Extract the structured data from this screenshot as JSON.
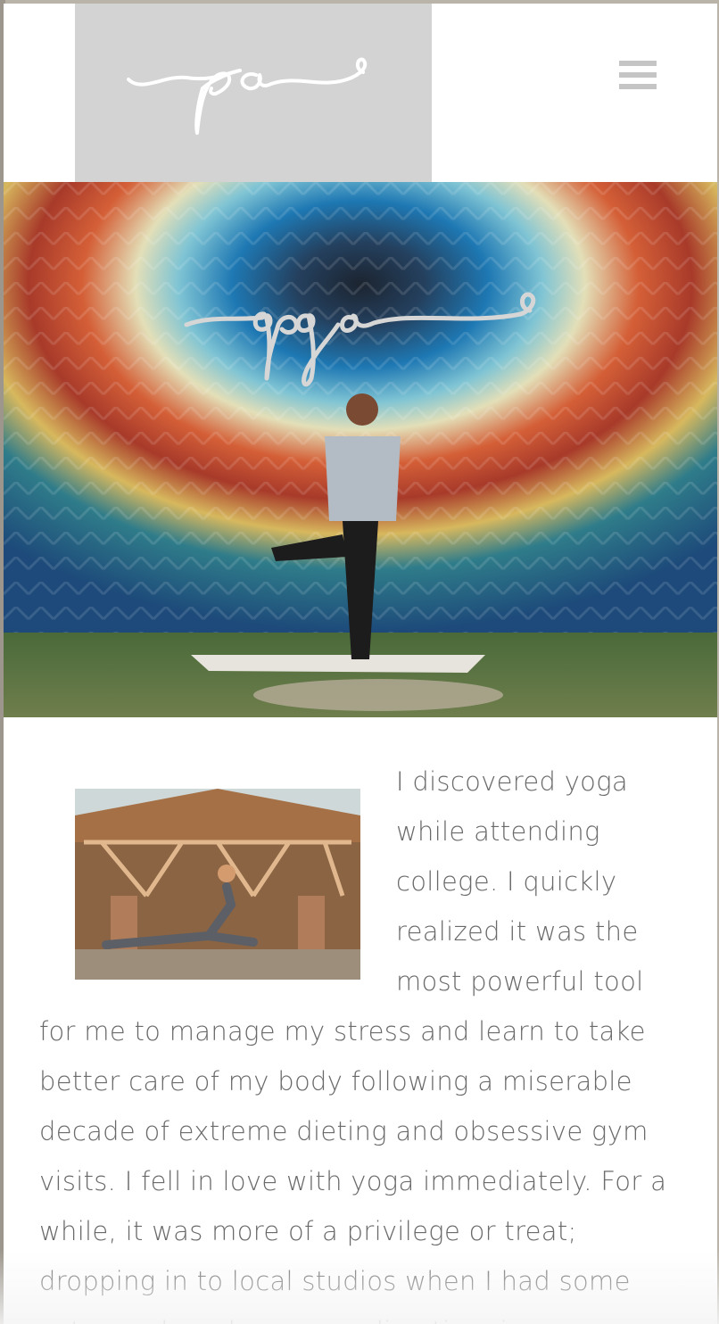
{
  "header": {
    "logo_text": "pa",
    "menu_icon": "hamburger-icon"
  },
  "hero": {
    "title": "yoga"
  },
  "content": {
    "body": "I discovered yoga while attending college. I quickly realized it was the most powerful tool for me to manage my stress and learn to take better care of my body following a miserable decade of extreme dieting and obsessive gym visits. I fell in love with yoga immediately. For a while, it was more of a privilege or treat; dropping in to local studios when I had some extra cash and was spending time in my"
  },
  "colors": {
    "logo_bg": "#d3d3d3",
    "text": "#6a6a6a",
    "menu_icon": "#c5c5c5"
  }
}
